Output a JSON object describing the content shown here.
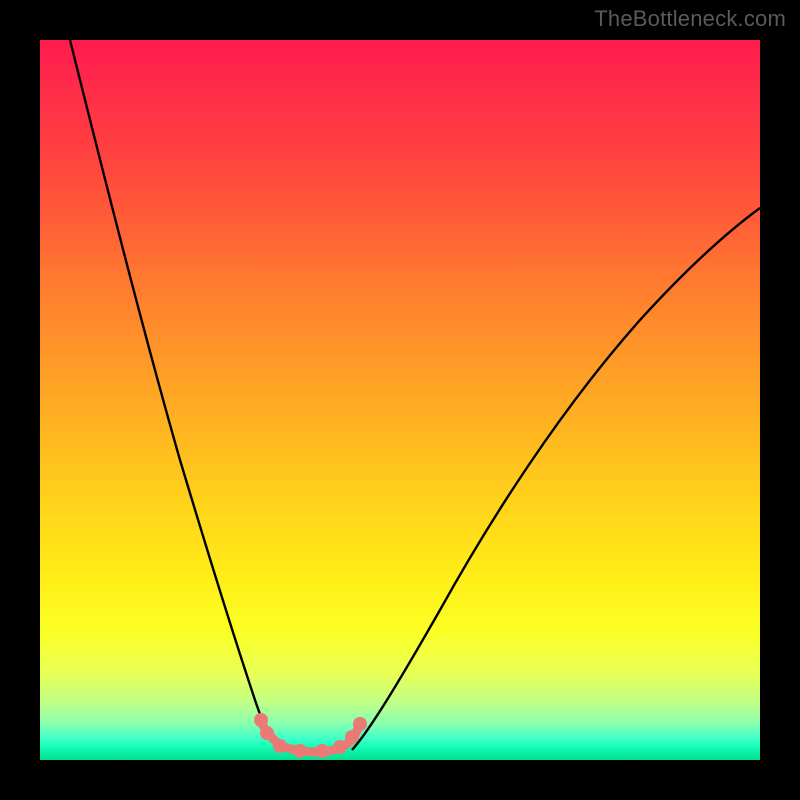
{
  "watermark": {
    "text": "TheBottleneck.com"
  },
  "gradient": {
    "stops": [
      {
        "pct": 0,
        "color": "#ff1a4e"
      },
      {
        "pct": 6,
        "color": "#ff2a4a"
      },
      {
        "pct": 16,
        "color": "#ff4240"
      },
      {
        "pct": 24,
        "color": "#ff5a38"
      },
      {
        "pct": 33,
        "color": "#ff7830"
      },
      {
        "pct": 44,
        "color": "#ff9828"
      },
      {
        "pct": 55,
        "color": "#ffb820"
      },
      {
        "pct": 65,
        "color": "#ffd51a"
      },
      {
        "pct": 75,
        "color": "#ffee18"
      },
      {
        "pct": 82,
        "color": "#fbff24"
      },
      {
        "pct": 88,
        "color": "#e8ff55"
      },
      {
        "pct": 92,
        "color": "#c0ff86"
      },
      {
        "pct": 95,
        "color": "#88ffb0"
      },
      {
        "pct": 97,
        "color": "#40ffc8"
      },
      {
        "pct": 98,
        "color": "#18ffb8"
      },
      {
        "pct": 100,
        "color": "#00e090"
      }
    ]
  },
  "chart_data": {
    "type": "line",
    "title": "",
    "xlabel": "",
    "ylabel": "",
    "xlim": [
      0,
      100
    ],
    "ylim": [
      0,
      100
    ],
    "grid": false,
    "series": [
      {
        "name": "curve-left",
        "stroke": "#000000",
        "x": [
          4,
          6,
          8,
          10,
          12,
          14,
          16,
          18,
          20,
          22,
          24,
          26,
          28,
          30,
          32
        ],
        "y": [
          100,
          92,
          83,
          74,
          66,
          58,
          50,
          42,
          34,
          27,
          20,
          14,
          9,
          5,
          2
        ]
      },
      {
        "name": "curve-right",
        "stroke": "#000000",
        "x": [
          44,
          48,
          52,
          56,
          60,
          64,
          68,
          72,
          76,
          80,
          84,
          88,
          92,
          96,
          100
        ],
        "y": [
          2,
          5,
          9,
          14,
          20,
          26,
          33,
          40,
          47,
          54,
          60,
          66,
          71,
          76,
          79
        ]
      },
      {
        "name": "valley-floor",
        "stroke": "#e97a76",
        "x": [
          30,
          32,
          34,
          36,
          38,
          40,
          42,
          44
        ],
        "y": [
          4,
          2,
          1.5,
          1.5,
          1.5,
          1.5,
          2,
          4
        ]
      }
    ],
    "markers": [
      {
        "series": "valley-floor",
        "x": 30.5,
        "y": 4.5,
        "color": "#e97a76"
      },
      {
        "series": "valley-floor",
        "x": 31.2,
        "y": 3.2,
        "color": "#e97a76"
      },
      {
        "series": "valley-floor",
        "x": 33.0,
        "y": 1.8,
        "color": "#e97a76"
      },
      {
        "series": "valley-floor",
        "x": 36.0,
        "y": 1.6,
        "color": "#e97a76"
      },
      {
        "series": "valley-floor",
        "x": 39.0,
        "y": 1.6,
        "color": "#e97a76"
      },
      {
        "series": "valley-floor",
        "x": 41.0,
        "y": 1.8,
        "color": "#e97a76"
      },
      {
        "series": "valley-floor",
        "x": 42.5,
        "y": 2.6,
        "color": "#e97a76"
      },
      {
        "series": "valley-floor",
        "x": 44.0,
        "y": 4.0,
        "color": "#e97a76"
      }
    ]
  }
}
